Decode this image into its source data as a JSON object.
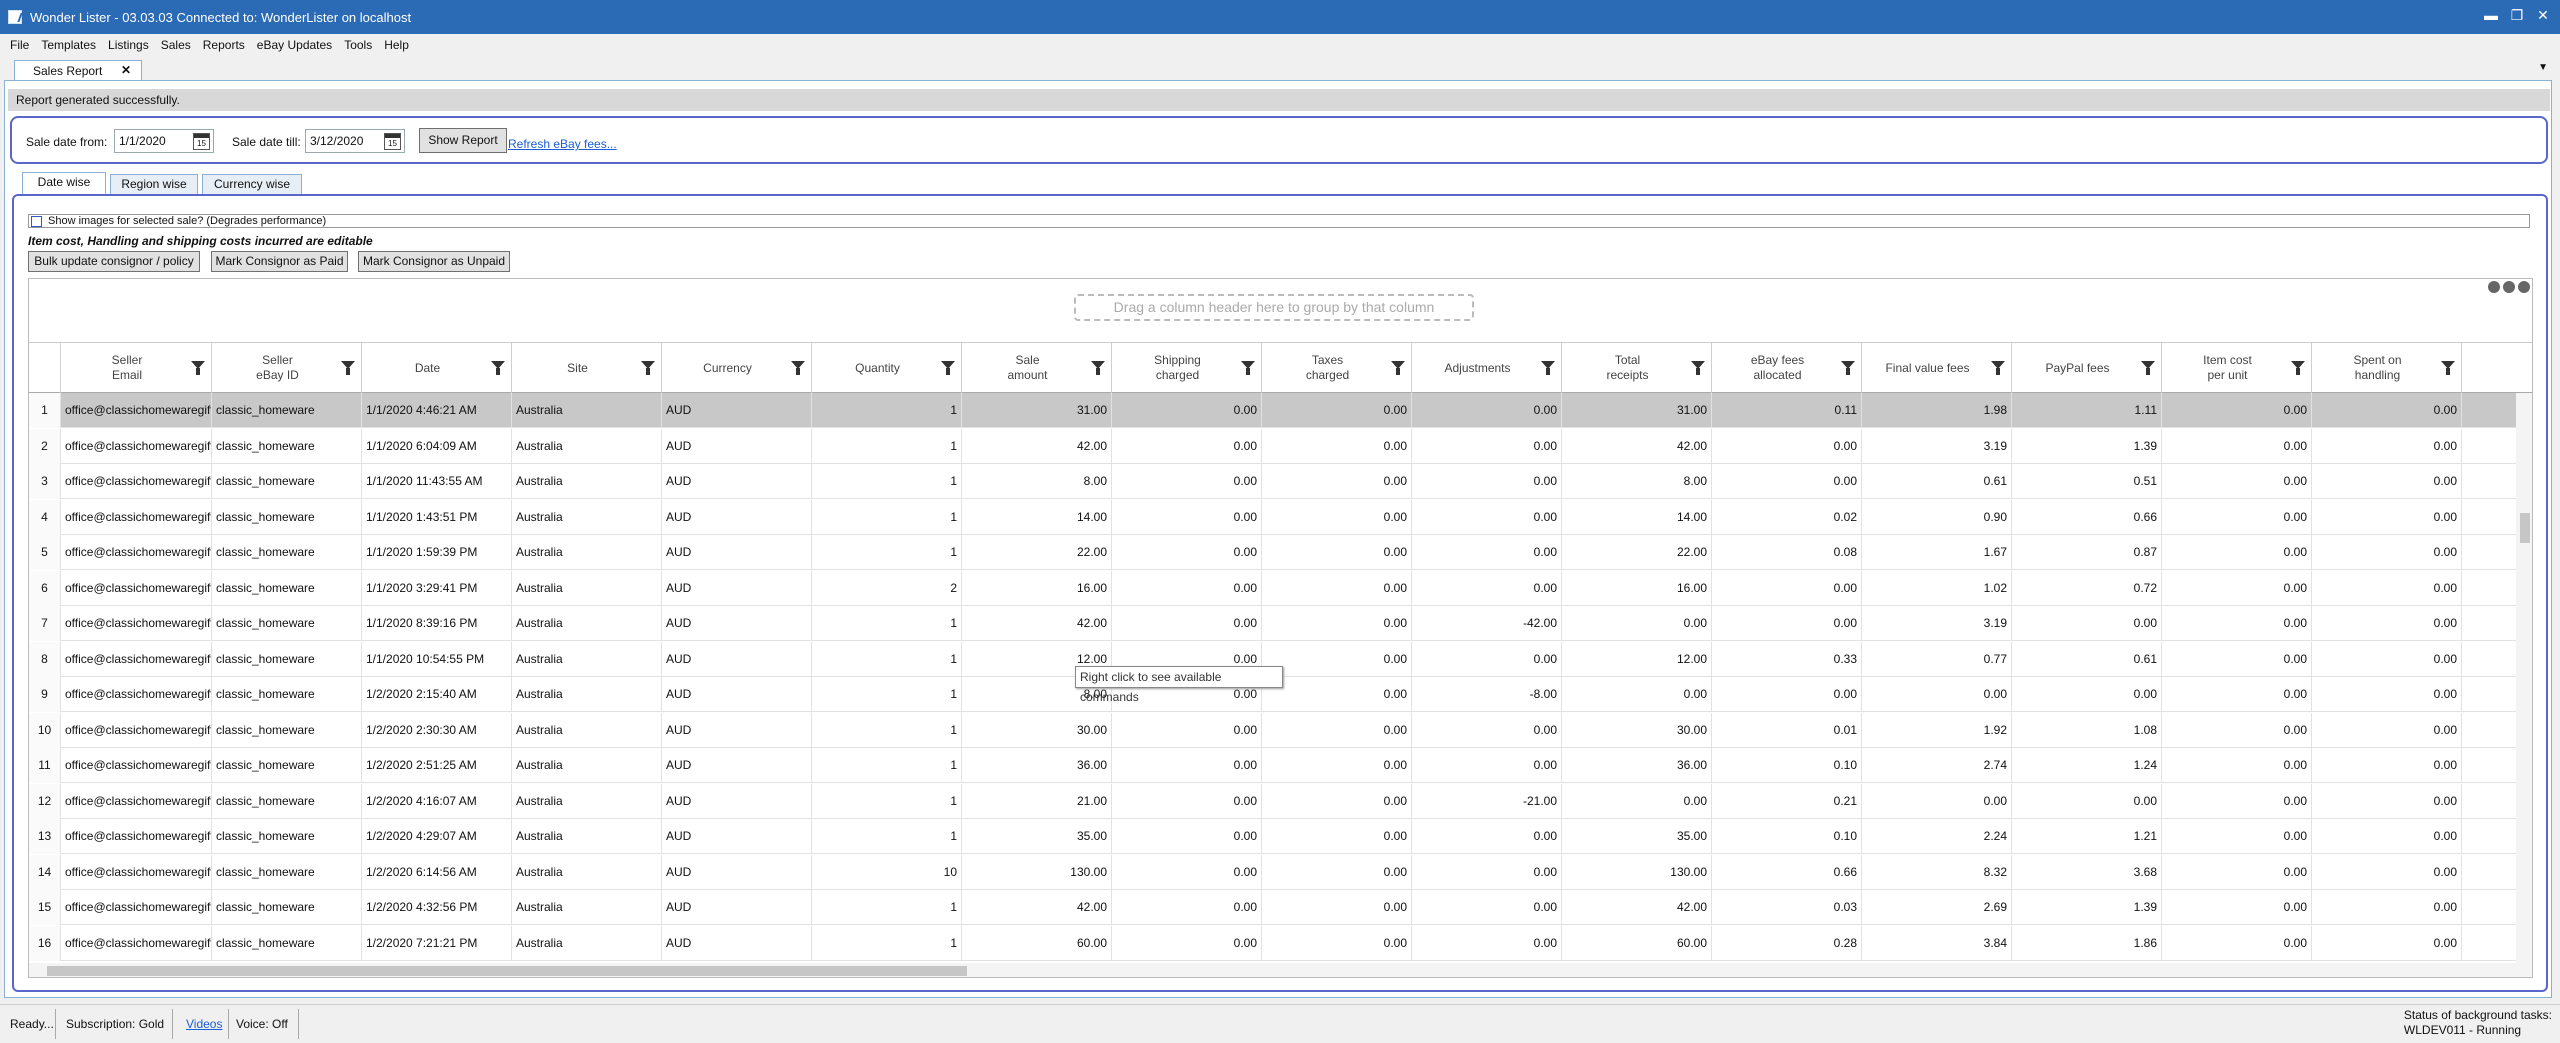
{
  "window": {
    "title": "Wonder Lister - 03.03.03 Connected to: WonderLister on localhost"
  },
  "menu": [
    "File",
    "Templates",
    "Listings",
    "Sales",
    "Reports",
    "eBay Updates",
    "Tools",
    "Help"
  ],
  "doc_tab": {
    "label": "Sales Report",
    "close": "✕"
  },
  "status_message": "Report generated successfully.",
  "filters": {
    "from_label": "Sale date from:",
    "from_value": "1/1/2020",
    "till_label": "Sale date till:",
    "till_value": "3/12/2020",
    "calendar_glyph": "15",
    "show_report": "Show Report",
    "refresh_link": "Refresh eBay fees..."
  },
  "report_tabs": [
    "Date wise",
    "Region wise",
    "Currency wise"
  ],
  "show_images_label": "Show images for selected sale? (Degrades performance)",
  "editable_note": "Item cost, Handling and shipping costs incurred are editable",
  "action_buttons": [
    "Bulk update consignor / policy",
    "Mark Consignor as Paid",
    "Mark Consignor as Unpaid"
  ],
  "grid": {
    "group_hint": "Drag a column header here to group by that column",
    "columns": [
      "Seller\nEmail",
      "Seller\neBay ID",
      "Date",
      "Site",
      "Currency",
      "Quantity",
      "Sale\namount",
      "Shipping\ncharged",
      "Taxes\ncharged",
      "Adjustments",
      "Total\nreceipts",
      "eBay fees\nallocated",
      "Final value fees",
      "PayPal fees",
      "Item cost\nper unit",
      "Spent on\nhandling"
    ],
    "rows": [
      [
        "1",
        "office@classichomewaregift",
        "classic_homeware",
        "1/1/2020 4:46:21 AM",
        "Australia",
        "AUD",
        "1",
        "31.00",
        "0.00",
        "0.00",
        "0.00",
        "31.00",
        "0.11",
        "1.98",
        "1.11",
        "0.00",
        "0.00"
      ],
      [
        "2",
        "office@classichomewaregift",
        "classic_homeware",
        "1/1/2020 6:04:09 AM",
        "Australia",
        "AUD",
        "1",
        "42.00",
        "0.00",
        "0.00",
        "0.00",
        "42.00",
        "0.00",
        "3.19",
        "1.39",
        "0.00",
        "0.00"
      ],
      [
        "3",
        "office@classichomewaregift",
        "classic_homeware",
        "1/1/2020 11:43:55 AM",
        "Australia",
        "AUD",
        "1",
        "8.00",
        "0.00",
        "0.00",
        "0.00",
        "8.00",
        "0.00",
        "0.61",
        "0.51",
        "0.00",
        "0.00"
      ],
      [
        "4",
        "office@classichomewaregift",
        "classic_homeware",
        "1/1/2020 1:43:51 PM",
        "Australia",
        "AUD",
        "1",
        "14.00",
        "0.00",
        "0.00",
        "0.00",
        "14.00",
        "0.02",
        "0.90",
        "0.66",
        "0.00",
        "0.00"
      ],
      [
        "5",
        "office@classichomewaregift",
        "classic_homeware",
        "1/1/2020 1:59:39 PM",
        "Australia",
        "AUD",
        "1",
        "22.00",
        "0.00",
        "0.00",
        "0.00",
        "22.00",
        "0.08",
        "1.67",
        "0.87",
        "0.00",
        "0.00"
      ],
      [
        "6",
        "office@classichomewaregift",
        "classic_homeware",
        "1/1/2020 3:29:41 PM",
        "Australia",
        "AUD",
        "2",
        "16.00",
        "0.00",
        "0.00",
        "0.00",
        "16.00",
        "0.00",
        "1.02",
        "0.72",
        "0.00",
        "0.00"
      ],
      [
        "7",
        "office@classichomewaregift",
        "classic_homeware",
        "1/1/2020 8:39:16 PM",
        "Australia",
        "AUD",
        "1",
        "42.00",
        "0.00",
        "0.00",
        "-42.00",
        "0.00",
        "0.00",
        "3.19",
        "0.00",
        "0.00",
        "0.00"
      ],
      [
        "8",
        "office@classichomewaregift",
        "classic_homeware",
        "1/1/2020 10:54:55 PM",
        "Australia",
        "AUD",
        "1",
        "12.00",
        "0.00",
        "0.00",
        "0.00",
        "12.00",
        "0.33",
        "0.77",
        "0.61",
        "0.00",
        "0.00"
      ],
      [
        "9",
        "office@classichomewaregift",
        "classic_homeware",
        "1/2/2020 2:15:40 AM",
        "Australia",
        "AUD",
        "1",
        "8.00",
        "0.00",
        "0.00",
        "-8.00",
        "0.00",
        "0.00",
        "0.00",
        "0.00",
        "0.00",
        "0.00"
      ],
      [
        "10",
        "office@classichomewaregift",
        "classic_homeware",
        "1/2/2020 2:30:30 AM",
        "Australia",
        "AUD",
        "1",
        "30.00",
        "0.00",
        "0.00",
        "0.00",
        "30.00",
        "0.01",
        "1.92",
        "1.08",
        "0.00",
        "0.00"
      ],
      [
        "11",
        "office@classichomewaregift",
        "classic_homeware",
        "1/2/2020 2:51:25 AM",
        "Australia",
        "AUD",
        "1",
        "36.00",
        "0.00",
        "0.00",
        "0.00",
        "36.00",
        "0.10",
        "2.74",
        "1.24",
        "0.00",
        "0.00"
      ],
      [
        "12",
        "office@classichomewaregift",
        "classic_homeware",
        "1/2/2020 4:16:07 AM",
        "Australia",
        "AUD",
        "1",
        "21.00",
        "0.00",
        "0.00",
        "-21.00",
        "0.00",
        "0.21",
        "0.00",
        "0.00",
        "0.00",
        "0.00"
      ],
      [
        "13",
        "office@classichomewaregift",
        "classic_homeware",
        "1/2/2020 4:29:07 AM",
        "Australia",
        "AUD",
        "1",
        "35.00",
        "0.00",
        "0.00",
        "0.00",
        "35.00",
        "0.10",
        "2.24",
        "1.21",
        "0.00",
        "0.00"
      ],
      [
        "14",
        "office@classichomewaregift",
        "classic_homeware",
        "1/2/2020 6:14:56 AM",
        "Australia",
        "AUD",
        "10",
        "130.00",
        "0.00",
        "0.00",
        "0.00",
        "130.00",
        "0.66",
        "8.32",
        "3.68",
        "0.00",
        "0.00"
      ],
      [
        "15",
        "office@classichomewaregift",
        "classic_homeware",
        "1/2/2020 4:32:56 PM",
        "Australia",
        "AUD",
        "1",
        "42.00",
        "0.00",
        "0.00",
        "0.00",
        "42.00",
        "0.03",
        "2.69",
        "1.39",
        "0.00",
        "0.00"
      ],
      [
        "16",
        "office@classichomewaregift",
        "classic_homeware",
        "1/2/2020 7:21:21 PM",
        "Australia",
        "AUD",
        "1",
        "60.00",
        "0.00",
        "0.00",
        "0.00",
        "60.00",
        "0.28",
        "3.84",
        "1.86",
        "0.00",
        "0.00"
      ]
    ]
  },
  "tooltip": "Right click to see available commands",
  "statusbar": {
    "ready": "Ready...",
    "subscription": "Subscription: Gold",
    "videos": "Videos",
    "voice": "Voice:  Off",
    "bg_label": "Status of background tasks:",
    "bg_value": "WLDEV011 - Running"
  },
  "colors": {
    "titlebar": "#2b6ab5",
    "accent_border": "#5a66cc",
    "link": "#1a5fd6",
    "selected_row": "#c8c8c8"
  },
  "icons": [
    "app-icon",
    "calendar-icon",
    "filter-icon",
    "minimize-icon",
    "restore-icon",
    "close-icon",
    "more-options-icon"
  ]
}
